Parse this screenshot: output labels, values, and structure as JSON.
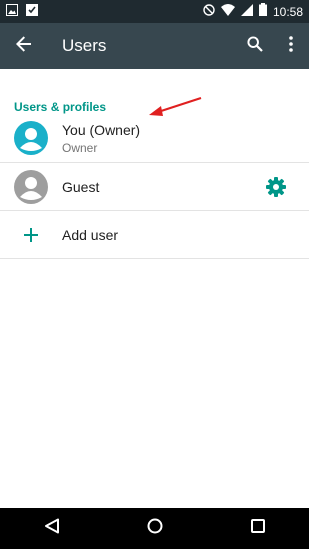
{
  "status_bar": {
    "time": "10:58",
    "icons": [
      "image-icon",
      "download-done-icon",
      "do-not-disturb-icon",
      "wifi-icon",
      "signal-icon",
      "battery-icon"
    ]
  },
  "toolbar": {
    "title": "Users",
    "back_icon": "arrow-back-icon",
    "search_icon": "search-icon",
    "menu_icon": "more-vert-icon"
  },
  "section": {
    "header": "Users & profiles"
  },
  "users": [
    {
      "name": "You (Owner)",
      "subtitle": "Owner",
      "avatar_color": "#1ab0c9"
    },
    {
      "name": "Guest",
      "subtitle": "",
      "avatar_color": "#9e9e9e"
    }
  ],
  "add_user": {
    "label": "Add user"
  },
  "colors": {
    "status_bar": "#1f2a30",
    "toolbar": "#37474f",
    "accent": "#009688",
    "annotation_arrow": "#e02020"
  },
  "nav_bar": {
    "buttons": [
      "back-triangle-icon",
      "home-circle-icon",
      "recents-square-icon"
    ]
  }
}
